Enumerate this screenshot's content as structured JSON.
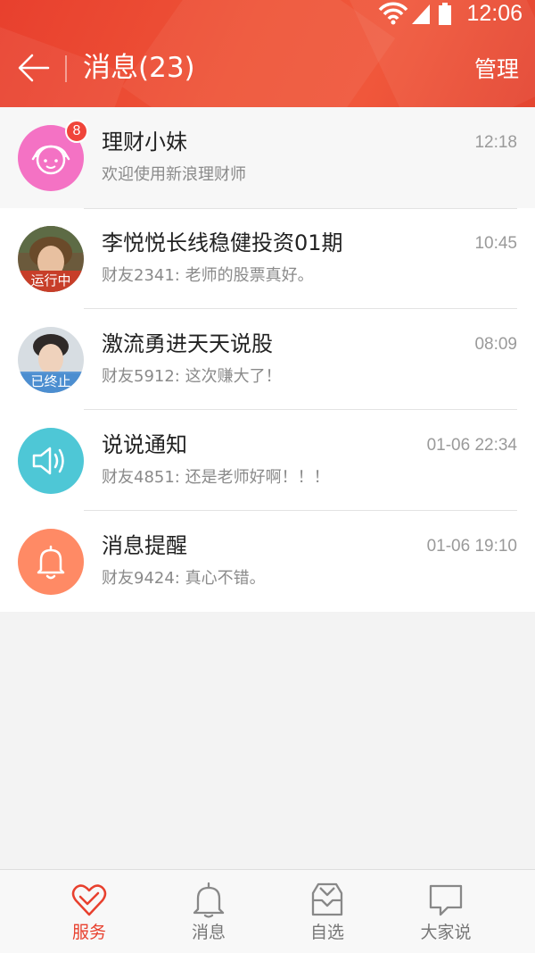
{
  "status_bar": {
    "time": "12:06"
  },
  "header": {
    "title": "消息(23)",
    "manage_label": "管理"
  },
  "colors": {
    "brand_red": "#e8402e",
    "pink": "#f472c4",
    "teal": "#4ec7d6",
    "orange": "#ff8a65"
  },
  "conversations": [
    {
      "title": "理财小妹",
      "subtitle": "欢迎使用新浪理财师",
      "time": "12:18",
      "badge": "8",
      "avatar_icon": "girl-face-icon"
    },
    {
      "title": "李悦悦长线稳健投资01期",
      "subtitle": "财友2341: 老师的股票真好。",
      "time": "10:45",
      "avatar_tag": "运行中"
    },
    {
      "title": "激流勇进天天说股",
      "subtitle": "财友5912: 这次赚大了！",
      "time": "08:09",
      "avatar_tag": "已终止"
    },
    {
      "title": "说说通知",
      "subtitle": "财友4851: 还是老师好啊！！！",
      "time": "01-06 22:34",
      "avatar_icon": "speaker-icon"
    },
    {
      "title": "消息提醒",
      "subtitle": "财友9424: 真心不错。",
      "time": "01-06 19:10",
      "avatar_icon": "bell-icon"
    }
  ],
  "tabs": [
    {
      "label": "服务",
      "icon": "heart-hand-icon",
      "active": true
    },
    {
      "label": "消息",
      "icon": "bell-icon",
      "active": false
    },
    {
      "label": "自选",
      "icon": "inbox-icon",
      "active": false
    },
    {
      "label": "大家说",
      "icon": "chat-bubble-icon",
      "active": false
    }
  ]
}
